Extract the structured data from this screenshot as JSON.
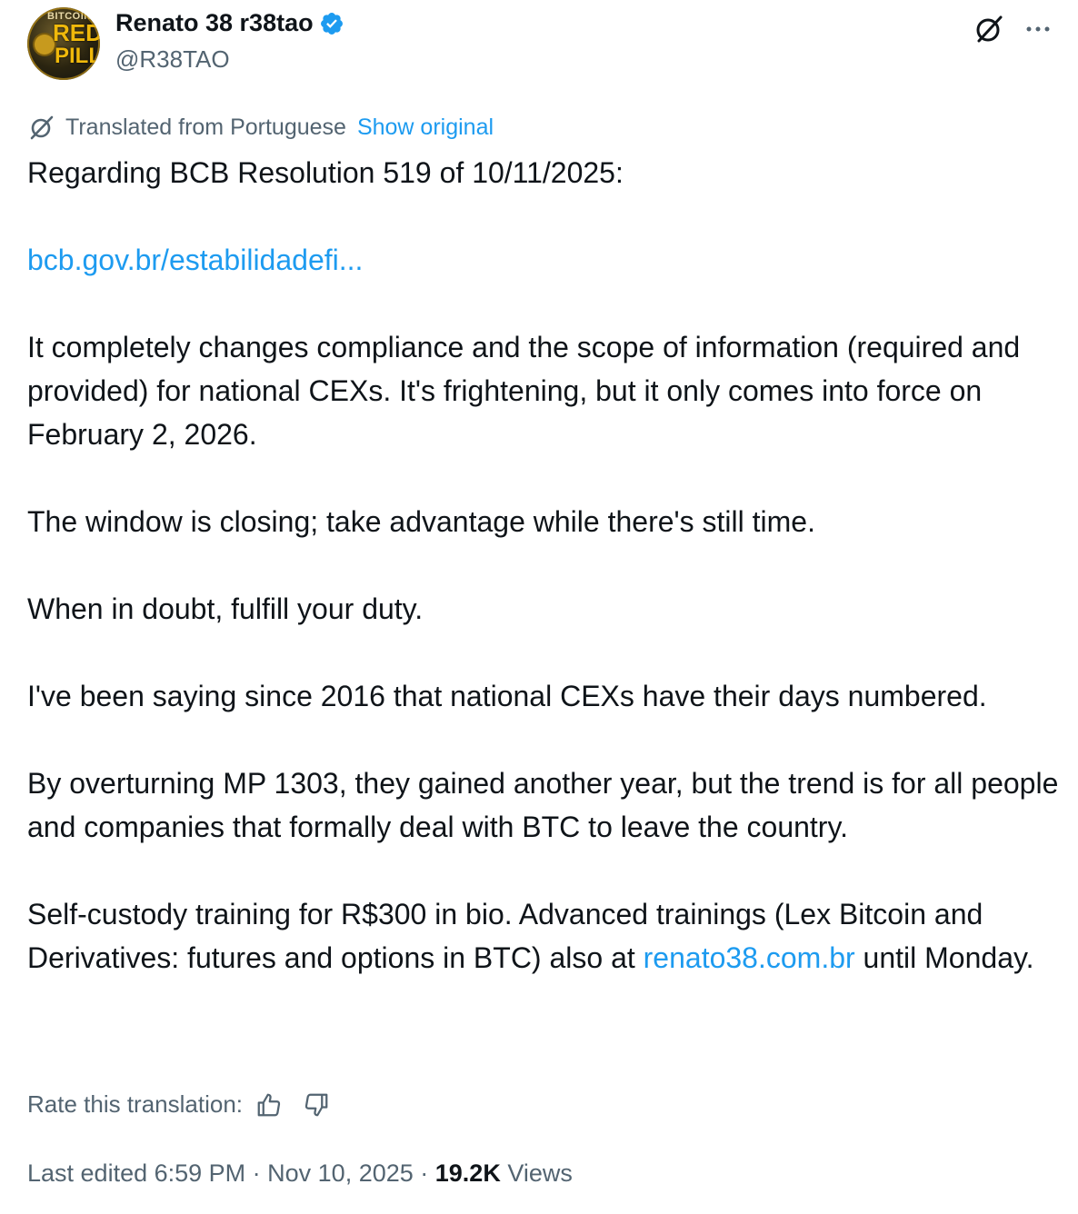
{
  "author": {
    "display_name": "Renato 38 r38tao",
    "handle": "@R38TAO",
    "avatar_text_top": "BITCOIN",
    "avatar_text_mid": "RED",
    "avatar_text_bottom": "PILL"
  },
  "translation": {
    "label": "Translated from Portuguese",
    "show_original": "Show original"
  },
  "post": {
    "p1": "Regarding BCB Resolution 519 of 10/11/2025:",
    "link1": "bcb.gov.br/estabilidadefi...",
    "p2": "It completely changes compliance and the scope of information (required and provided) for national CEXs. It's frightening, but it only comes into force on February 2, 2026.",
    "p3": "The window is closing; take advantage while there's still time.",
    "p4": "When in doubt, fulfill your duty.",
    "p5": "I've been saying since 2016 that national CEXs have their days numbered.",
    "p6": "By overturning MP 1303, they gained another year, but the trend is for all people and companies that formally deal with BTC to leave the country.",
    "p7_before": "Self-custody training for R$300 in bio. Advanced trainings (Lex Bitcoin and Derivatives: futures and options in BTC) also at ",
    "p7_link": "renato38.com.br",
    "p7_after": " until Monday."
  },
  "rate": {
    "label": "Rate this translation:"
  },
  "meta": {
    "edited_time": "Last edited 6:59 PM · Nov 10, 2025 · ",
    "views_count": "19.2K",
    "views_label": " Views"
  },
  "colors": {
    "link": "#1d9bf0",
    "secondary": "#536471",
    "text": "#0f1419"
  },
  "icons": [
    "verified-badge-icon",
    "grok-icon",
    "more-icon",
    "translate-icon",
    "thumbs-up-icon",
    "thumbs-down-icon"
  ]
}
